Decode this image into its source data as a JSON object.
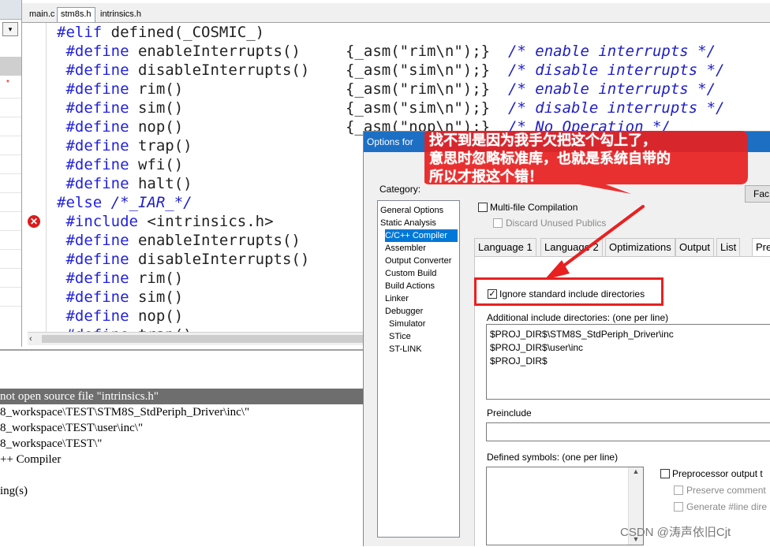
{
  "editor": {
    "tabs": [
      "main.c",
      "stm8s.h",
      "intrinsics.h"
    ],
    "active_tab": "stm8s.h",
    "code_lines": [
      [
        {
          "t": "#elif",
          "c": "kw"
        },
        {
          "t": " defined(_COSMIC_)",
          "c": ""
        }
      ],
      [
        {
          "t": " #define",
          "c": "kw"
        },
        {
          "t": " enableInterrupts()     {_asm(\"rim\\n\");}  ",
          "c": ""
        },
        {
          "t": "/* enable interrupts */",
          "c": "cm"
        }
      ],
      [
        {
          "t": " #define",
          "c": "kw"
        },
        {
          "t": " disableInterrupts()    {_asm(\"sim\\n\");}  ",
          "c": ""
        },
        {
          "t": "/* disable interrupts */",
          "c": "cm"
        }
      ],
      [
        {
          "t": " #define",
          "c": "kw"
        },
        {
          "t": " rim()                  {_asm(\"rim\\n\");}  ",
          "c": ""
        },
        {
          "t": "/* enable interrupts */",
          "c": "cm"
        }
      ],
      [
        {
          "t": " #define",
          "c": "kw"
        },
        {
          "t": " sim()                  {_asm(\"sim\\n\");}  ",
          "c": ""
        },
        {
          "t": "/* disable interrupts */",
          "c": "cm"
        }
      ],
      [
        {
          "t": " #define",
          "c": "kw"
        },
        {
          "t": " nop()                  {_asm(\"nop\\n\");}  ",
          "c": ""
        },
        {
          "t": "/* No Operation */",
          "c": "cm"
        }
      ],
      [
        {
          "t": " #define",
          "c": "kw"
        },
        {
          "t": " trap()",
          "c": ""
        }
      ],
      [
        {
          "t": " #define",
          "c": "kw"
        },
        {
          "t": " wfi()",
          "c": ""
        }
      ],
      [
        {
          "t": " #define",
          "c": "kw"
        },
        {
          "t": " halt()",
          "c": ""
        }
      ],
      [
        {
          "t": "#else",
          "c": "kw"
        },
        {
          "t": " ",
          "c": ""
        },
        {
          "t": "/*_IAR_*/",
          "c": "cm"
        }
      ],
      [
        {
          "t": " #include",
          "c": "kw"
        },
        {
          "t": " <intrinsics.h>",
          "c": ""
        }
      ],
      [
        {
          "t": " #define",
          "c": "kw"
        },
        {
          "t": " enableInterrupts()",
          "c": ""
        }
      ],
      [
        {
          "t": " #define",
          "c": "kw"
        },
        {
          "t": " disableInterrupts()",
          "c": ""
        }
      ],
      [
        {
          "t": " #define",
          "c": "kw"
        },
        {
          "t": " rim()",
          "c": ""
        }
      ],
      [
        {
          "t": " #define",
          "c": "kw"
        },
        {
          "t": " sim()",
          "c": ""
        }
      ],
      [
        {
          "t": " #define",
          "c": "kw"
        },
        {
          "t": " nop()",
          "c": ""
        }
      ],
      [
        {
          "t": " #define",
          "c": "kw"
        },
        {
          "t": " trap()",
          "c": ""
        }
      ]
    ],
    "error_marker_icon": "error-circle-icon"
  },
  "build_output": {
    "error_line": "not open source file \"intrinsics.h\"",
    "lines": [
      "8_workspace\\TEST\\STM8S_StdPeriph_Driver\\inc\\\"",
      "8_workspace\\TEST\\user\\inc\\\"",
      "8_workspace\\TEST\\\"",
      "++ Compiler",
      "",
      "ing(s)"
    ]
  },
  "dialog": {
    "title": "Options for",
    "category_label": "Category:",
    "categories": [
      {
        "label": "General Options",
        "level": 0
      },
      {
        "label": "Static Analysis",
        "level": 0
      },
      {
        "label": "C/C++ Compiler",
        "level": 1,
        "selected": true
      },
      {
        "label": "Assembler",
        "level": 1
      },
      {
        "label": "Output Converter",
        "level": 1
      },
      {
        "label": "Custom Build",
        "level": 1
      },
      {
        "label": "Build Actions",
        "level": 1
      },
      {
        "label": "Linker",
        "level": 1
      },
      {
        "label": "Debugger",
        "level": 1
      },
      {
        "label": "Simulator",
        "level": 2
      },
      {
        "label": "STice",
        "level": 2
      },
      {
        "label": "ST-LINK",
        "level": 2
      }
    ],
    "factory_button": "Fac",
    "multi_file": {
      "label": "Multi-file Compilation",
      "checked": false
    },
    "discard_publics": {
      "label": "Discard Unused Publics",
      "checked": false
    },
    "tabs": [
      "Language 1",
      "Language 2",
      "Optimizations",
      "Output",
      "List",
      "Pre"
    ],
    "active_tab": "Pre",
    "ignore_std": {
      "label": "Ignore standard include directories",
      "checked": true
    },
    "include_label": "Additional include directories: (one per line)",
    "include_dirs": [
      "$PROJ_DIR$\\STM8S_StdPeriph_Driver\\inc",
      "$PROJ_DIR$\\user\\inc",
      "$PROJ_DIR$"
    ],
    "preinclude_label": "Preinclude",
    "preinclude_value": "",
    "defined_label": "Defined symbols: (one per line)",
    "preproc_output": {
      "label": "Preprocessor output t",
      "checked": false
    },
    "preserve_comments": {
      "label": "Preserve comment",
      "checked": false
    },
    "generate_line": {
      "label": "Generate #line dire",
      "checked": false
    }
  },
  "annotation": {
    "lines": [
      "找不到是因为我手欠把这个勾上了，",
      "意思时忽略标准库，也就是系统自带的",
      "所以才报这个错！"
    ],
    "color": "#e82020"
  },
  "watermark": "CSDN @涛声依旧Cjt"
}
